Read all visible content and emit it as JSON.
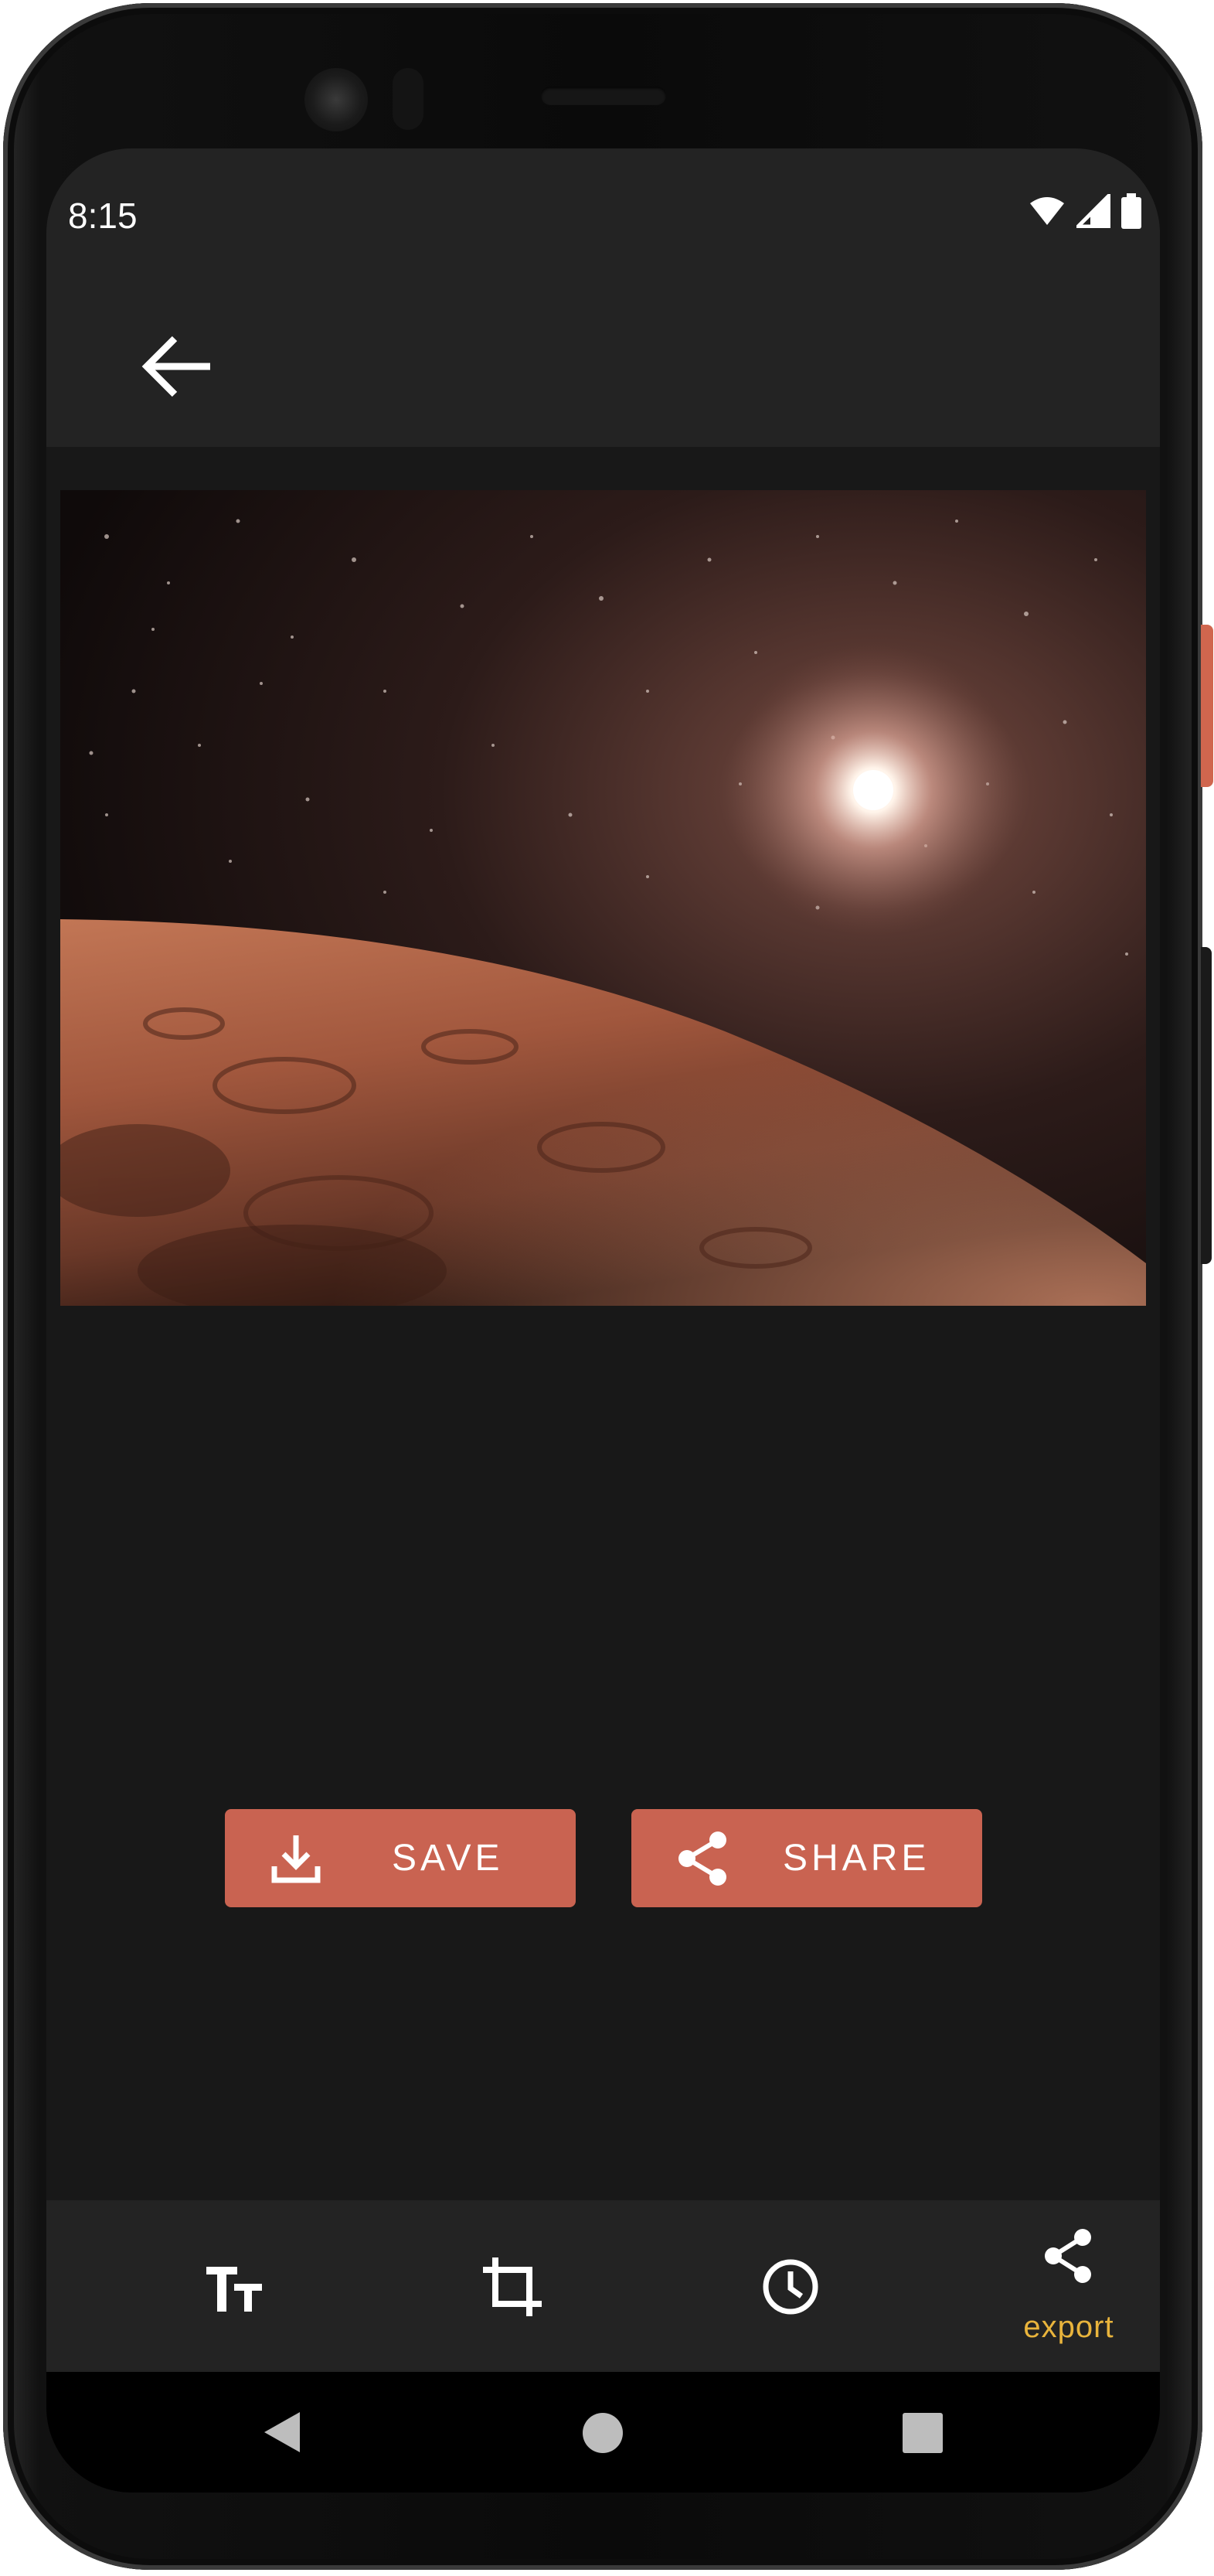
{
  "status_bar": {
    "time": "8:15",
    "icons": [
      "wifi-icon",
      "cell-signal-icon",
      "battery-icon"
    ]
  },
  "app_bar": {
    "back_icon": "arrow-back-icon"
  },
  "preview": {
    "image_subject": "mars-horizon-with-sun"
  },
  "actions": {
    "save_label": "SAVE",
    "save_icon": "download-icon",
    "share_label": "SHARE",
    "share_icon": "share-icon"
  },
  "bottom_nav": {
    "items": [
      {
        "icon": "text-size-icon",
        "label": "",
        "selected": false
      },
      {
        "icon": "crop-icon",
        "label": "",
        "selected": false
      },
      {
        "icon": "clock-icon",
        "label": "",
        "selected": false
      },
      {
        "icon": "share-icon",
        "label": "export",
        "selected": true
      }
    ]
  },
  "system_nav": {
    "buttons": [
      "back-triangle-icon",
      "home-circle-icon",
      "recents-square-icon"
    ]
  },
  "colors": {
    "accent": "#c96351",
    "selected_label": "#e9b43c",
    "surface": "#232323",
    "background": "#181818"
  }
}
